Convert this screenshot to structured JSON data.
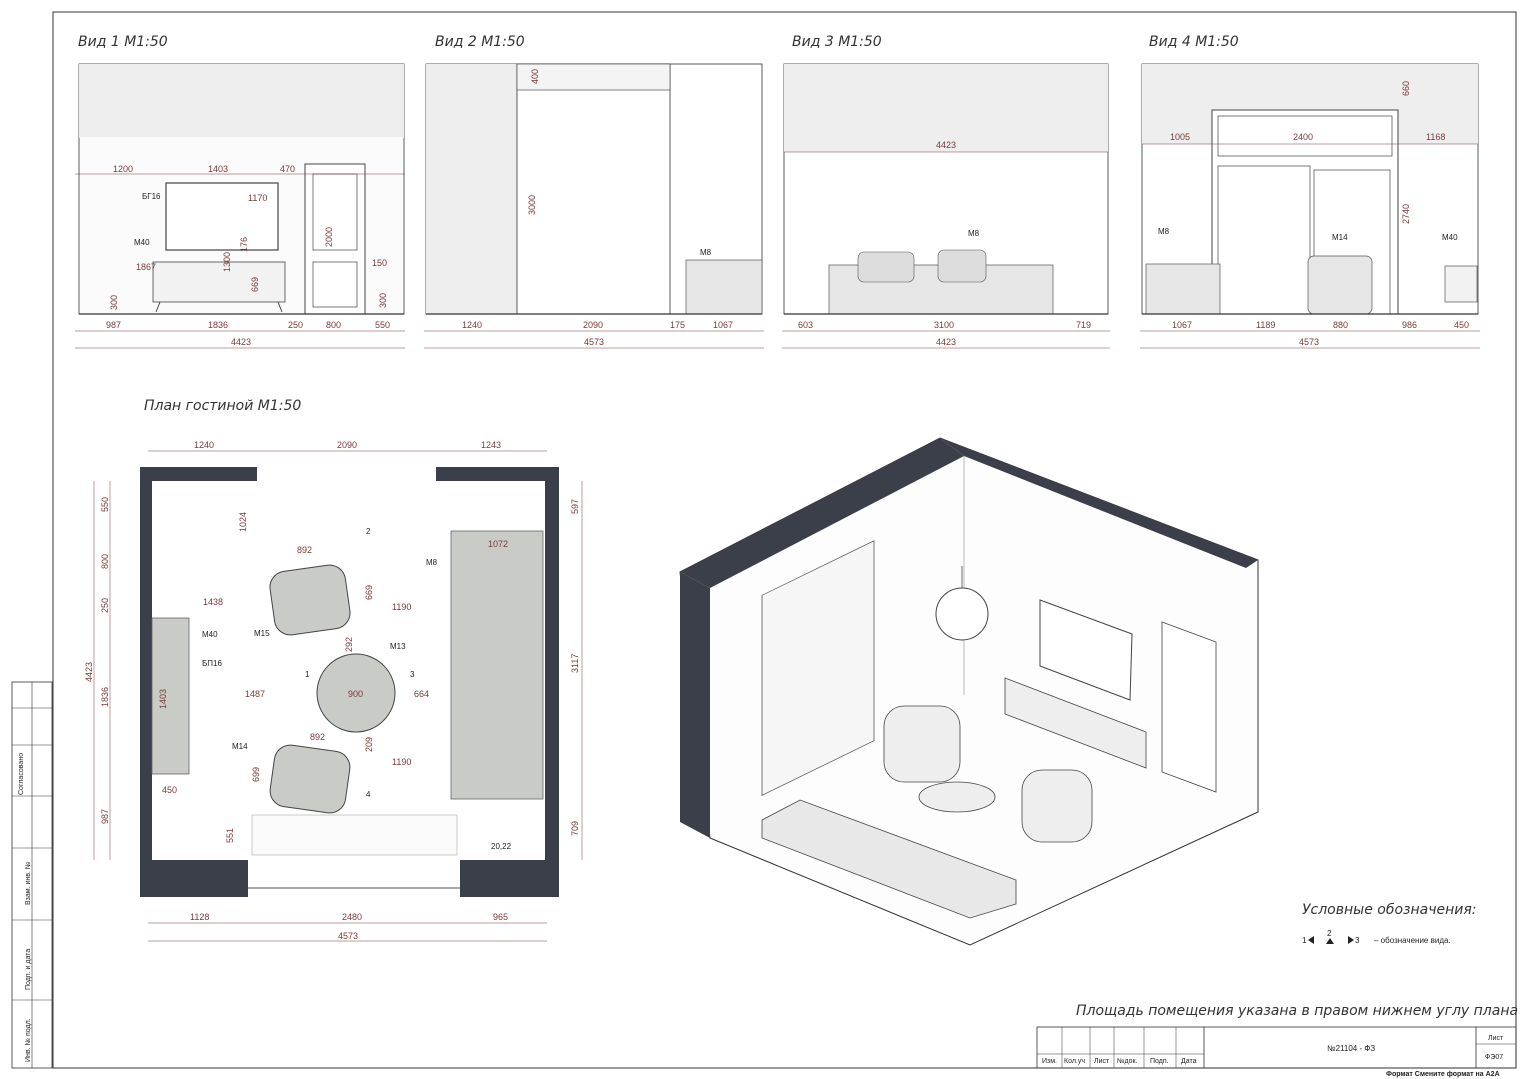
{
  "views": [
    {
      "title": "Вид 1 М1:50",
      "top_dims": [
        "1200",
        "1403",
        "470"
      ],
      "inner_dims": [
        "1170",
        "176",
        "1300",
        "669",
        "1867",
        "2000",
        "150",
        "300",
        "300"
      ],
      "bottom_dims": [
        "987",
        "1836",
        "250",
        "800",
        "550"
      ],
      "total": "4423",
      "tags": [
        "БГ16",
        "М40"
      ]
    },
    {
      "title": "Вид 2 М1:50",
      "inner_dims": [
        "400",
        "3000"
      ],
      "bottom_dims": [
        "1240",
        "2090",
        "175",
        "1067"
      ],
      "total": "4573",
      "tags": [
        "М8"
      ]
    },
    {
      "title": "Вид 3 М1:50",
      "top_dims": [
        "4423"
      ],
      "bottom_dims": [
        "603",
        "3100",
        "719"
      ],
      "total": "4423",
      "tags": [
        "М8"
      ]
    },
    {
      "title": "Вид 4 М1:50",
      "top_dims": [
        "1005",
        "2400",
        "1168"
      ],
      "inner_dims": [
        "660",
        "2740"
      ],
      "bottom_dims": [
        "1067",
        "1189",
        "880",
        "986",
        "450"
      ],
      "total": "4573",
      "tags": [
        "М8",
        "М14",
        "М40"
      ]
    }
  ],
  "plan": {
    "title": "План гостиной М1:50",
    "top_dims": [
      "1240",
      "2090",
      "1243"
    ],
    "left_dims": [
      "550",
      "800",
      "250",
      "1836",
      "987"
    ],
    "left_total": "4423",
    "right_dims": [
      "597",
      "3117",
      "709"
    ],
    "inner_dims": [
      "1024",
      "892",
      "669",
      "1438",
      "1190",
      "292",
      "1487",
      "900",
      "664",
      "1403",
      "892",
      "699",
      "209",
      "1190",
      "450",
      "551",
      "1072"
    ],
    "bottom_dims": [
      "1128",
      "2480",
      "965"
    ],
    "bottom_total": "4573",
    "tags": [
      "М8",
      "М15",
      "М13",
      "М40",
      "БП16",
      "М14"
    ],
    "view_markers": [
      "1",
      "2",
      "3",
      "4"
    ],
    "area": "20,22"
  },
  "legend": {
    "title": "Условные обозначения:",
    "marker_1": "1",
    "marker_2": "2",
    "marker_3": "3",
    "text": "– обозначение вида."
  },
  "note": "Площадь помещения указана в правом нижнем углу плана",
  "stamp": {
    "doc_number": "№21104 - ФЗ",
    "headers": [
      "Изм.",
      "Кол.уч",
      "Лист",
      "№док.",
      "Подп.",
      "Дата"
    ],
    "sheet_label": "Лист",
    "sheet_value": "ФЭ07",
    "format_text": "Формат Смените формат на А2А"
  },
  "side_stamp": [
    "Согласовано",
    "Взам. инв. №",
    "Подп. и дата",
    "Инв. № подл."
  ]
}
